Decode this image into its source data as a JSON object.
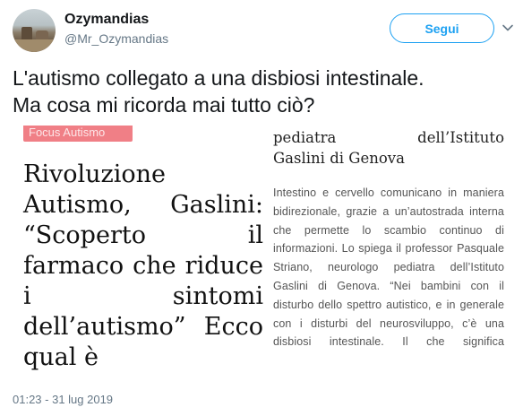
{
  "user": {
    "display_name": "Ozymandias",
    "handle": "@Mr_Ozymandias"
  },
  "follow_button": {
    "label": "Segui"
  },
  "tweet": {
    "line1": "L'autismo collegato a una disbiosi intestinale.",
    "line2": "Ma cosa mi ricorda mai tutto ciò?",
    "timestamp": "01:23 - 31 lug 2019"
  },
  "article": {
    "badge": "Focus Autismo",
    "headline": "Rivoluzione Autismo, Gaslini: “Scoperto il farmaco che riduce i sintomi dell’autismo” Ecco qual è",
    "subtitle_a": "pediatra",
    "subtitle_b": "dell’Istituto",
    "subtitle_c": "Gaslini di Genova",
    "body": "Intestino e cervello comunicano in maniera bidirezionale, grazie a un’autostrada interna che permette lo scambio continuo di informazioni. Lo spiega il professor Pasquale Striano, neurologo pediatra dell’Istituto Gaslini di Genova. “Nei bambini con il disturbo dello spettro autistico, e in generale con i disturbi del neurosviluppo, c’è una disbiosi intestinale. Il che significa"
  },
  "colors": {
    "twitter_blue": "#1da1f2",
    "badge_bg": "#f07f86",
    "muted": "#657786"
  },
  "icons": {
    "chevron": "chevron-down-icon"
  }
}
